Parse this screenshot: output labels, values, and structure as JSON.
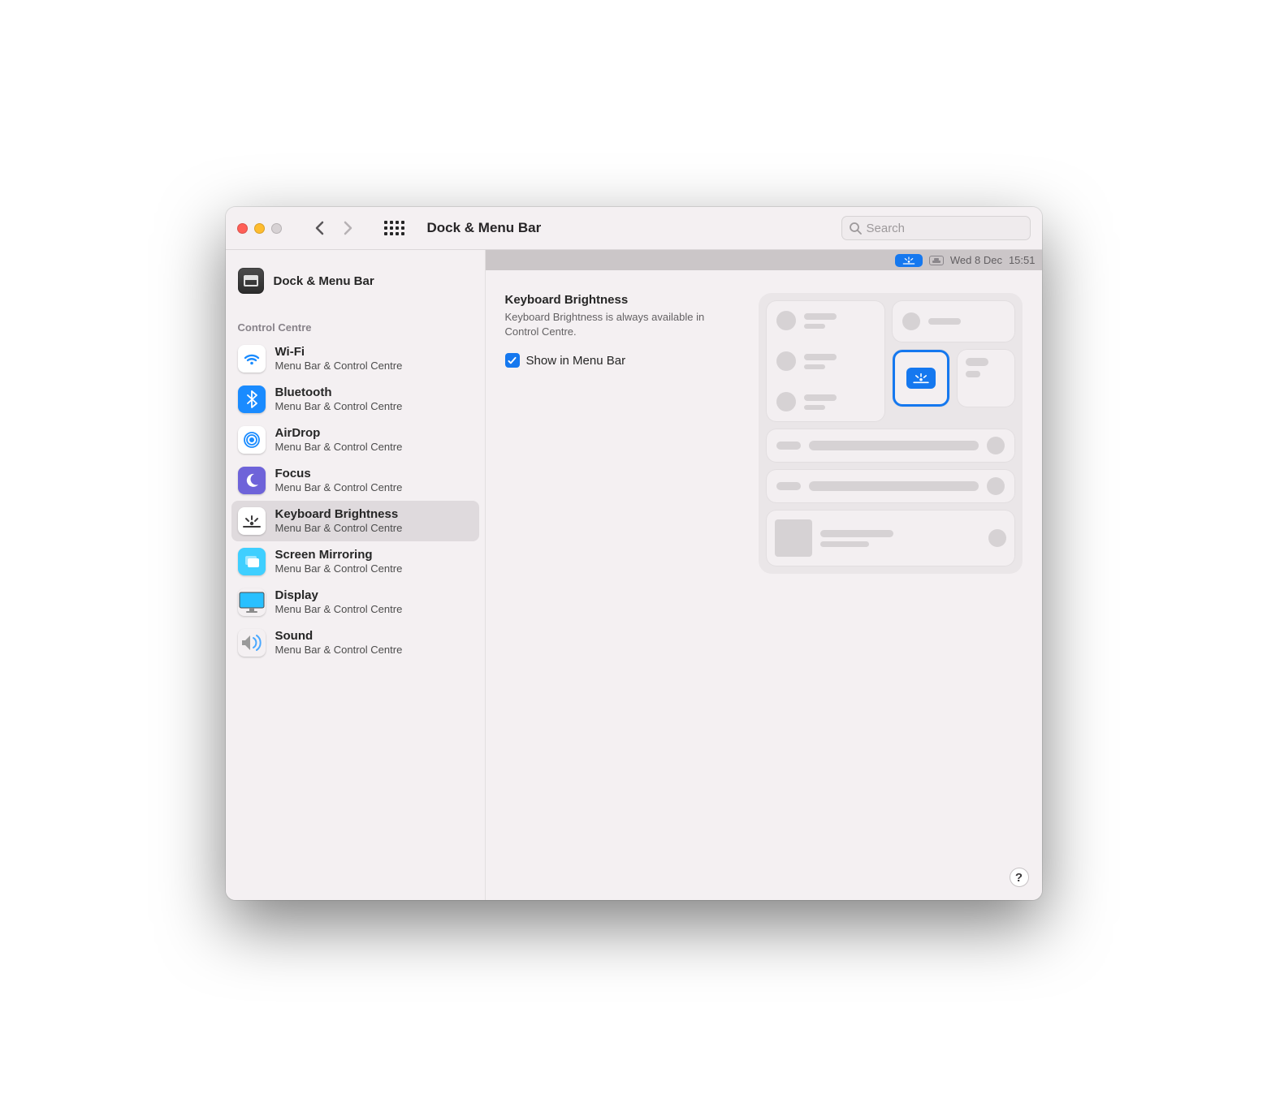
{
  "window": {
    "title": "Dock & Menu Bar",
    "search_placeholder": "Search"
  },
  "sidebar": {
    "top_item": "Dock & Menu Bar",
    "section_header": "Control Centre",
    "items": [
      {
        "name": "Wi-Fi",
        "sub": "Menu Bar & Control Centre"
      },
      {
        "name": "Bluetooth",
        "sub": "Menu Bar & Control Centre"
      },
      {
        "name": "AirDrop",
        "sub": "Menu Bar & Control Centre"
      },
      {
        "name": "Focus",
        "sub": "Menu Bar & Control Centre"
      },
      {
        "name": "Keyboard Brightness",
        "sub": "Menu Bar & Control Centre"
      },
      {
        "name": "Screen Mirroring",
        "sub": "Menu Bar & Control Centre"
      },
      {
        "name": "Display",
        "sub": "Menu Bar & Control Centre"
      },
      {
        "name": "Sound",
        "sub": "Menu Bar & Control Centre"
      }
    ],
    "selected_index": 4
  },
  "menubar_preview": {
    "date": "Wed 8 Dec",
    "time": "15:51"
  },
  "detail": {
    "heading": "Keyboard Brightness",
    "description": "Keyboard Brightness is always available in Control Centre.",
    "checkbox_label": "Show in Menu Bar",
    "checkbox_checked": true
  },
  "help_glyph": "?"
}
